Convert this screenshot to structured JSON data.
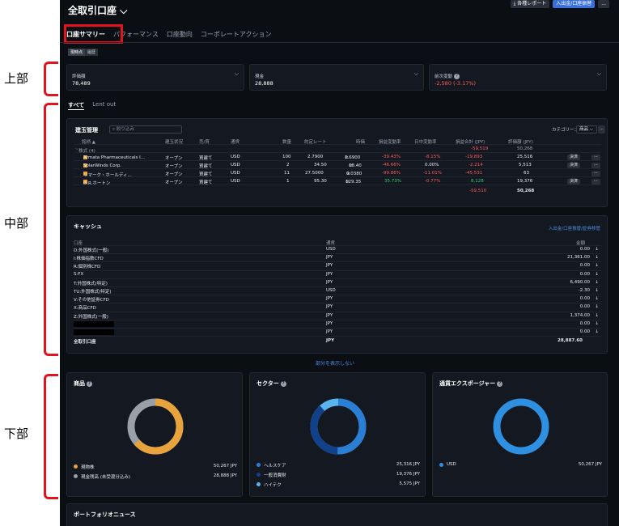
{
  "annotations": {
    "top": "上部",
    "middle": "中部",
    "bottom": "下部"
  },
  "header": {
    "title": "全取引口座",
    "report_btn": "各種レポート",
    "deposit_btn": "入出金/口座振替",
    "more_btn": "..."
  },
  "tabs": [
    "口座サマリー",
    "パフォーマンス",
    "口座動向",
    "コーポレートアクション"
  ],
  "sub_tabs": [
    "現時点",
    "履歴"
  ],
  "summary": [
    {
      "label": "評価額",
      "value": "78,489"
    },
    {
      "label": "現金",
      "value": "28,888"
    },
    {
      "label": "前次変動",
      "value": "-2,580 (-3.17%)"
    }
  ],
  "position_tabs": [
    "すべて",
    "Lent out"
  ],
  "positions": {
    "title": "建玉管理",
    "search_placeholder": "絞り込み",
    "category_label": "カテゴリー：",
    "category_value": "商品",
    "columns": [
      "銘柄 ▲",
      "建玉状況",
      "売/買",
      "通貨",
      "数量",
      "約定レート",
      "時価",
      "損益変動率",
      "日中変動率",
      "損益合計 (JPY)",
      "評価額 (JPY)"
    ],
    "group": {
      "label": "株式 (4)",
      "pl": "-59,519",
      "value": "50,268"
    },
    "rows": [
      {
        "name": "Armata Pharmaceuticals I...",
        "status": "オープン",
        "side": "買建て",
        "ccy": "USD",
        "qty": "100",
        "price": "2.7900",
        "mkt": "1.6900",
        "chg": "-39.43%",
        "day": "-8.15%",
        "pl": "-19,893",
        "val": "25,516",
        "action": "決済"
      },
      {
        "name": "SolarWinds Corp.",
        "status": "オープン",
        "side": "買建て",
        "ccy": "USD",
        "qty": "2",
        "price": "34.50",
        "mkt": "18.40",
        "chg": "-46.66%",
        "day": "0.00%",
        "pl": "-2,214",
        "val": "5,513",
        "action": "決済"
      },
      {
        "name": "リマーク・ホールディ...",
        "status": "オープン",
        "side": "買建て",
        "ccy": "USD",
        "qty": "11",
        "price": "27.5000",
        "mkt": "0.0380",
        "chg": "-99.86%",
        "day": "-11.01%",
        "pl": "-45,531",
        "val": "63",
        "action": ""
      },
      {
        "name": "D.R.ホートン",
        "status": "オープン",
        "side": "買建て",
        "ccy": "USD",
        "qty": "1",
        "price": "95.30",
        "mkt": "129.35",
        "chg": "35.73%",
        "day": "-0.77%",
        "pl": "8,128",
        "val": "19,376",
        "action": "決済"
      }
    ],
    "total": {
      "pl": "-59,510",
      "val": "50,268"
    }
  },
  "cash": {
    "title": "キャッシュ",
    "links": "入出金/口座振替/証券移管",
    "columns": [
      "口座",
      "通貨",
      "金額"
    ],
    "rows": [
      {
        "acct": "D:外国株式(一般)",
        "ccy": "USD",
        "amt": "0.00"
      },
      {
        "acct": "I:株価指数CFD",
        "ccy": "JPY",
        "amt": "21,361.00"
      },
      {
        "acct": "R:個別株CFD",
        "ccy": "JPY",
        "amt": "0.00"
      },
      {
        "acct": "S:FX",
        "ccy": "JPY",
        "amt": "0.00"
      },
      {
        "acct": "T:外国株式(特定)",
        "ccy": "JPY",
        "amt": "6,490.00"
      },
      {
        "acct": "TU:外国株式(特定)",
        "ccy": "USD",
        "amt": "-2.30"
      },
      {
        "acct": "V:その他証券CFD",
        "ccy": "JPY",
        "amt": "0.00"
      },
      {
        "acct": "X:商品CFD",
        "ccy": "JPY",
        "amt": "0.00"
      },
      {
        "acct": "Z:外国株式(一般)",
        "ccy": "JPY",
        "amt": "1,374.00"
      },
      {
        "acct": "",
        "ccy": "JPY",
        "amt": "0.00"
      },
      {
        "acct": "",
        "ccy": "JPY",
        "amt": "0.00"
      }
    ],
    "total": {
      "acct": "全取引口座",
      "ccy": "JPY",
      "amt": "28,887.60"
    }
  },
  "toggle_link": "部分を表示しない",
  "charts": [
    {
      "title": "商品",
      "legend": [
        {
          "label": "現物株",
          "value": "50,267 JPY",
          "color": "#e8a33c"
        },
        {
          "label": "現金残高 (未受渡分込み)",
          "value": "28,888 JPY",
          "color": "#9aa0a8"
        }
      ]
    },
    {
      "title": "セクター",
      "legend": [
        {
          "label": "ヘルスケア",
          "value": "25,316 JPY",
          "color": "#2a7fd4"
        },
        {
          "label": "一般消費財",
          "value": "19,376 JPY",
          "color": "#10418a"
        },
        {
          "label": "ハイテク",
          "value": "5,575 JPY",
          "color": "#5ab4f0"
        }
      ]
    },
    {
      "title": "通貨エクスポージャー",
      "legend": [
        {
          "label": "USD",
          "value": "50,267 JPY",
          "color": "#2f8fe0"
        }
      ]
    }
  ],
  "news": {
    "title": "ポートフォリオニュース"
  }
}
